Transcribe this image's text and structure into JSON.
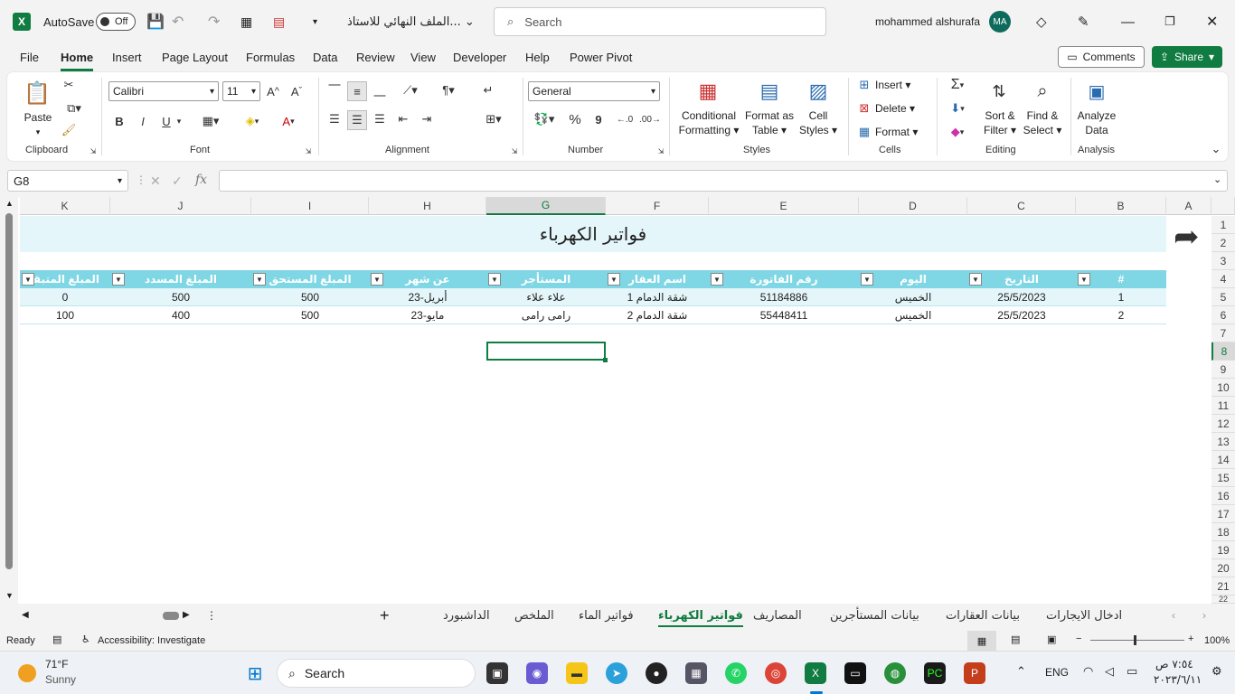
{
  "titlebar": {
    "autosave_label": "AutoSave",
    "autosave_state": "Off",
    "file_name": "الملف النهائي للاستاذ...",
    "search_placeholder": "Search",
    "user_name": "mohammed alshurafa",
    "user_initials": "MA"
  },
  "menu": {
    "items": [
      "File",
      "Home",
      "Insert",
      "Page Layout",
      "Formulas",
      "Data",
      "Review",
      "View",
      "Developer",
      "Help",
      "Power Pivot"
    ],
    "active": "Home",
    "comments_label": "Comments",
    "share_label": "Share"
  },
  "ribbon": {
    "clipboard": {
      "paste": "Paste",
      "label": "Clipboard"
    },
    "font": {
      "name": "Calibri",
      "size": "11",
      "label": "Font",
      "bold": "B",
      "italic": "I",
      "underline": "U"
    },
    "alignment": {
      "label": "Alignment"
    },
    "number": {
      "format": "General",
      "label": "Number",
      "percent": "%",
      "comma": "9"
    },
    "styles": {
      "conditional_line1": "Conditional",
      "conditional_line2": "Formatting",
      "format_table_line1": "Format as",
      "format_table_line2": "Table",
      "cell_styles_line1": "Cell",
      "cell_styles_line2": "Styles",
      "label": "Styles"
    },
    "cells": {
      "insert": "Insert",
      "delete": "Delete",
      "format": "Format",
      "label": "Cells"
    },
    "editing": {
      "sort_line1": "Sort &",
      "sort_line2": "Filter",
      "find_line1": "Find &",
      "find_line2": "Select",
      "label": "Editing"
    },
    "analysis": {
      "analyze_line1": "Analyze",
      "analyze_line2": "Data",
      "label": "Analysis"
    }
  },
  "formula": {
    "name_box": "G8",
    "fx": "fx",
    "value": ""
  },
  "columns": [
    "A",
    "B",
    "C",
    "D",
    "E",
    "F",
    "G",
    "H",
    "I",
    "J",
    "K"
  ],
  "rows": [
    "1",
    "2",
    "3",
    "4",
    "5",
    "6",
    "7",
    "8",
    "9",
    "10",
    "11",
    "12",
    "13",
    "14",
    "15",
    "16",
    "17",
    "18",
    "19",
    "20",
    "21",
    "22"
  ],
  "sheet": {
    "title": "فواتير الكهرباء",
    "headers": [
      "#",
      "التاريخ",
      "اليوم",
      "رقم الفاتورة",
      "اسم العقار",
      "المستأجر",
      "عن شهر",
      "المبلغ المستحق",
      "المبلغ المسدد",
      "المبلغ المتبقي"
    ],
    "data": [
      [
        "1",
        "25/5/2023",
        "الخميس",
        "51184886",
        "شقة الدمام 1",
        "علاء علاء",
        "أبريل-23",
        "500",
        "500",
        "0"
      ],
      [
        "2",
        "25/5/2023",
        "الخميس",
        "55448411",
        "شقة الدمام 2",
        "رامى رامى",
        "مايو-23",
        "500",
        "400",
        "100"
      ]
    ],
    "colors": {
      "header": "#7fd6e4",
      "title_bg": "#e4f6fa",
      "accent": "#107c41"
    }
  },
  "tabs": {
    "add": "+",
    "items": [
      "الداشبورد",
      "الملخص",
      "فواتير الماء",
      "فواتير الكهرباء",
      "المصاريف",
      "بيانات المستأجرين",
      "بيانات العقارات",
      "ادخال الايجارات"
    ],
    "active": "فواتير الكهرباء"
  },
  "status": {
    "ready": "Ready",
    "accessibility": "Accessibility: Investigate",
    "zoom": "100%"
  },
  "taskbar": {
    "weather_temp": "71°F",
    "weather_desc": "Sunny",
    "search": "Search",
    "lang": "ENG",
    "time": "٧:٥٤ ص",
    "date": "٢٠٢٣/٦/١١"
  }
}
